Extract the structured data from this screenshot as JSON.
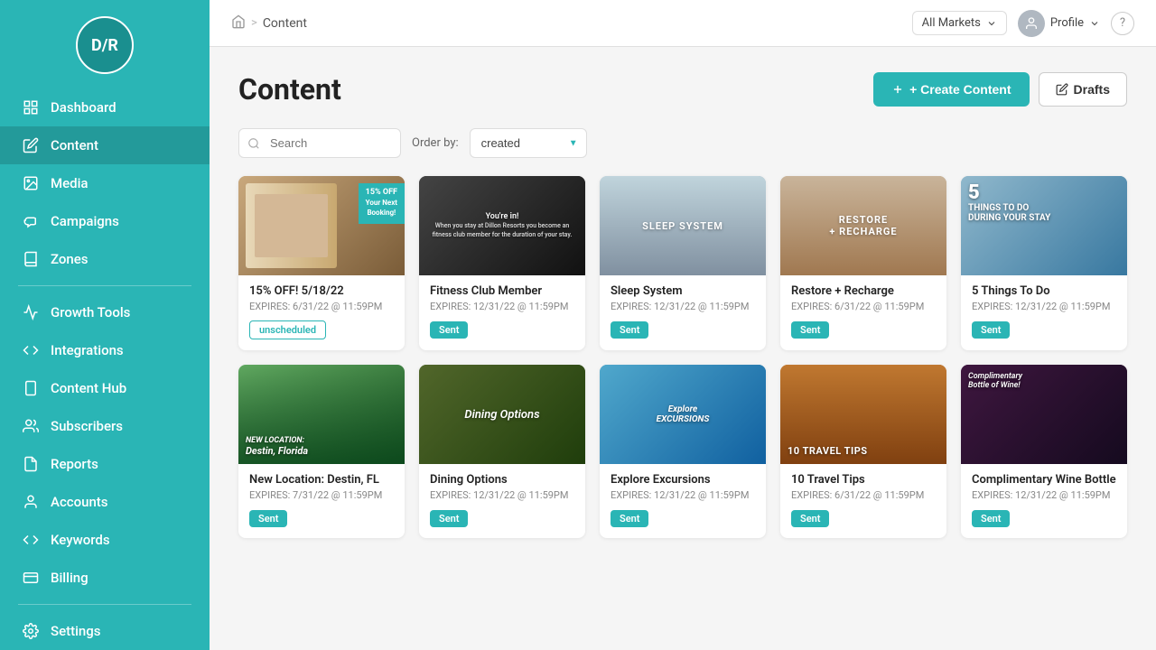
{
  "logo": {
    "text": "D/R"
  },
  "sidebar": {
    "items": [
      {
        "id": "dashboard",
        "label": "Dashboard",
        "icon": "chart-icon",
        "active": false
      },
      {
        "id": "content",
        "label": "Content",
        "icon": "pencil-icon",
        "active": true
      },
      {
        "id": "media",
        "label": "Media",
        "icon": "image-icon",
        "active": false
      },
      {
        "id": "campaigns",
        "label": "Campaigns",
        "icon": "megaphone-icon",
        "active": false
      },
      {
        "id": "zones",
        "label": "Zones",
        "icon": "book-icon",
        "active": false
      },
      {
        "id": "growth-tools",
        "label": "Growth Tools",
        "icon": "tool-icon",
        "active": false
      },
      {
        "id": "integrations",
        "label": "Integrations",
        "icon": "code-icon",
        "active": false
      },
      {
        "id": "content-hub",
        "label": "Content Hub",
        "icon": "phone-icon",
        "active": false
      },
      {
        "id": "subscribers",
        "label": "Subscribers",
        "icon": "users-icon",
        "active": false
      },
      {
        "id": "reports",
        "label": "Reports",
        "icon": "file-icon",
        "active": false
      },
      {
        "id": "accounts",
        "label": "Accounts",
        "icon": "account-icon",
        "active": false
      },
      {
        "id": "keywords",
        "label": "Keywords",
        "icon": "keywords-icon",
        "active": false
      },
      {
        "id": "billing",
        "label": "Billing",
        "icon": "billing-icon",
        "active": false
      }
    ],
    "settings_label": "Settings"
  },
  "topbar": {
    "home_title": "Home",
    "breadcrumb_sep": ">",
    "current_page": "Content",
    "market_selector": "All Markets",
    "profile_label": "Profile",
    "help_label": "?"
  },
  "content_page": {
    "title": "Content",
    "create_btn": "+ Create Content",
    "drafts_btn": "Drafts",
    "filter": {
      "order_label": "Order by:",
      "search_placeholder": "Search",
      "order_value": "created"
    },
    "cards": [
      {
        "id": 1,
        "title": "15% OFF! 5/18/22",
        "expires": "EXPIRES: 6/31/22 @ 11:59PM",
        "badge": "unscheduled",
        "thumb_label": "15% OFF!\nYour Next\nBooking!",
        "thumb_class": "thumb-1"
      },
      {
        "id": 2,
        "title": "Fitness Club Member",
        "expires": "EXPIRES: 12/31/22 @ 11:59PM",
        "badge": "sent",
        "thumb_label": "You're in!\nFitness Club Member",
        "thumb_class": "thumb-2"
      },
      {
        "id": 3,
        "title": "Sleep System",
        "expires": "EXPIRES: 12/31/22 @ 11:59PM",
        "badge": "sent",
        "thumb_label": "SLEEP SYSTEM",
        "thumb_class": "thumb-3"
      },
      {
        "id": 4,
        "title": "Restore + Recharge",
        "expires": "EXPIRES: 6/31/22 @ 11:59PM",
        "badge": "sent",
        "thumb_label": "RESTORE\n+ RECHARGE",
        "thumb_class": "thumb-4"
      },
      {
        "id": 5,
        "title": "5 Things To Do",
        "expires": "EXPIRES: 12/31/22 @ 11:59PM",
        "badge": "sent",
        "thumb_label": "5 THINGS TO DO\nDURING YOUR STAY",
        "thumb_class": "thumb-5"
      },
      {
        "id": 6,
        "title": "New Location: Destin, FL",
        "expires": "EXPIRES: 7/31/22 @ 11:59PM",
        "badge": "sent",
        "thumb_label": "NEW LOCATION:\nDestin, Florida",
        "thumb_class": "thumb-6"
      },
      {
        "id": 7,
        "title": "Dining Options",
        "expires": "EXPIRES: 12/31/22 @ 11:59PM",
        "badge": "sent",
        "thumb_label": "Dining Options",
        "thumb_class": "thumb-6"
      },
      {
        "id": 8,
        "title": "Explore Excursions",
        "expires": "EXPIRES: 12/31/22 @ 11:59PM",
        "badge": "sent",
        "thumb_label": "Explore\nEXCURSIONS",
        "thumb_class": "thumb-7"
      },
      {
        "id": 9,
        "title": "10 Travel Tips",
        "expires": "EXPIRES: 6/31/22 @ 11:59PM",
        "badge": "sent",
        "thumb_label": "10 TRAVEL TIPS",
        "thumb_class": "thumb-8"
      },
      {
        "id": 10,
        "title": "Complimentary Wine Bottle",
        "expires": "EXPIRES: 12/31/22 @ 11:59PM",
        "badge": "sent",
        "thumb_label": "Complimentary\nBottle of Wine!",
        "thumb_class": "thumb-9"
      }
    ]
  }
}
